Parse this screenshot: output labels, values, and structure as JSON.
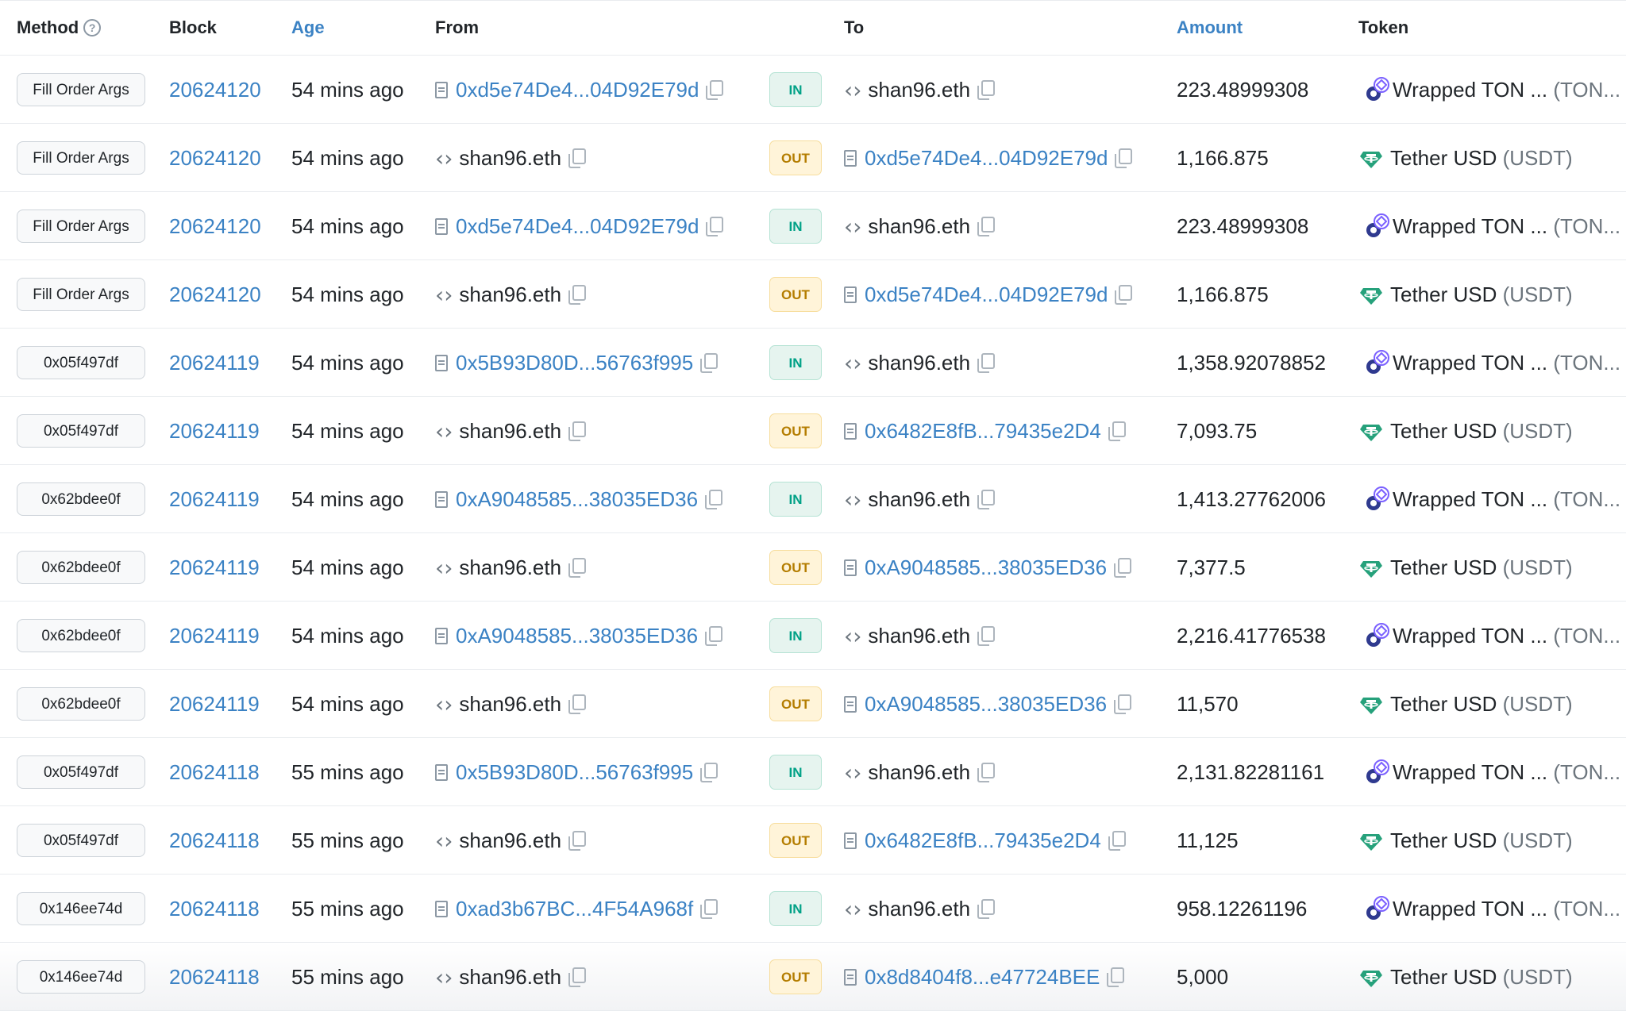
{
  "header": {
    "method": "Method",
    "block": "Block",
    "age": "Age",
    "from": "From",
    "to": "To",
    "amount": "Amount",
    "token": "Token"
  },
  "icons": {
    "help": "question-circle-icon",
    "contract": "document-icon",
    "address": "code-icon",
    "copy": "copy-icon",
    "ton": "wrapped-ton-icon",
    "tether": "tether-icon"
  },
  "colors": {
    "link": "#3b82c4",
    "in_badge": "#00a186",
    "out_badge": "#b47d00",
    "tether": "#26a17b",
    "ton": "#5b5bd6"
  },
  "tokens": {
    "ton_name": "Wrapped TON ...",
    "ton_symbol": "(TON...",
    "usdt_name": "Tether USD",
    "usdt_symbol": "(USDT)"
  },
  "rows": [
    {
      "method": "Fill Order Args",
      "block": "20624120",
      "age": "54 mins ago",
      "from": "0xd5e74De4...04D92E79d",
      "direction": "IN",
      "to": "shan96.eth",
      "amount": "223.48999308"
    },
    {
      "method": "Fill Order Args",
      "block": "20624120",
      "age": "54 mins ago",
      "from": "shan96.eth",
      "direction": "OUT",
      "to": "0xd5e74De4...04D92E79d",
      "amount": "1,166.875"
    },
    {
      "method": "Fill Order Args",
      "block": "20624120",
      "age": "54 mins ago",
      "from": "0xd5e74De4...04D92E79d",
      "direction": "IN",
      "to": "shan96.eth",
      "amount": "223.48999308"
    },
    {
      "method": "Fill Order Args",
      "block": "20624120",
      "age": "54 mins ago",
      "from": "shan96.eth",
      "direction": "OUT",
      "to": "0xd5e74De4...04D92E79d",
      "amount": "1,166.875"
    },
    {
      "method": "0x05f497df",
      "block": "20624119",
      "age": "54 mins ago",
      "from": "0x5B93D80D...56763f995",
      "direction": "IN",
      "to": "shan96.eth",
      "amount": "1,358.92078852"
    },
    {
      "method": "0x05f497df",
      "block": "20624119",
      "age": "54 mins ago",
      "from": "shan96.eth",
      "direction": "OUT",
      "to": "0x6482E8fB...79435e2D4",
      "amount": "7,093.75"
    },
    {
      "method": "0x62bdee0f",
      "block": "20624119",
      "age": "54 mins ago",
      "from": "0xA9048585...38035ED36",
      "direction": "IN",
      "to": "shan96.eth",
      "amount": "1,413.27762006"
    },
    {
      "method": "0x62bdee0f",
      "block": "20624119",
      "age": "54 mins ago",
      "from": "shan96.eth",
      "direction": "OUT",
      "to": "0xA9048585...38035ED36",
      "amount": "7,377.5"
    },
    {
      "method": "0x62bdee0f",
      "block": "20624119",
      "age": "54 mins ago",
      "from": "0xA9048585...38035ED36",
      "direction": "IN",
      "to": "shan96.eth",
      "amount": "2,216.41776538"
    },
    {
      "method": "0x62bdee0f",
      "block": "20624119",
      "age": "54 mins ago",
      "from": "shan96.eth",
      "direction": "OUT",
      "to": "0xA9048585...38035ED36",
      "amount": "11,570"
    },
    {
      "method": "0x05f497df",
      "block": "20624118",
      "age": "55 mins ago",
      "from": "0x5B93D80D...56763f995",
      "direction": "IN",
      "to": "shan96.eth",
      "amount": "2,131.82281161"
    },
    {
      "method": "0x05f497df",
      "block": "20624118",
      "age": "55 mins ago",
      "from": "shan96.eth",
      "direction": "OUT",
      "to": "0x6482E8fB...79435e2D4",
      "amount": "11,125"
    },
    {
      "method": "0x146ee74d",
      "block": "20624118",
      "age": "55 mins ago",
      "from": "0xad3b67BC...4F54A968f",
      "direction": "IN",
      "to": "shan96.eth",
      "amount": "958.12261196"
    },
    {
      "method": "0x146ee74d",
      "block": "20624118",
      "age": "55 mins ago",
      "from": "shan96.eth",
      "direction": "OUT",
      "to": "0x8d8404f8...e47724BEE",
      "amount": "5,000"
    }
  ]
}
